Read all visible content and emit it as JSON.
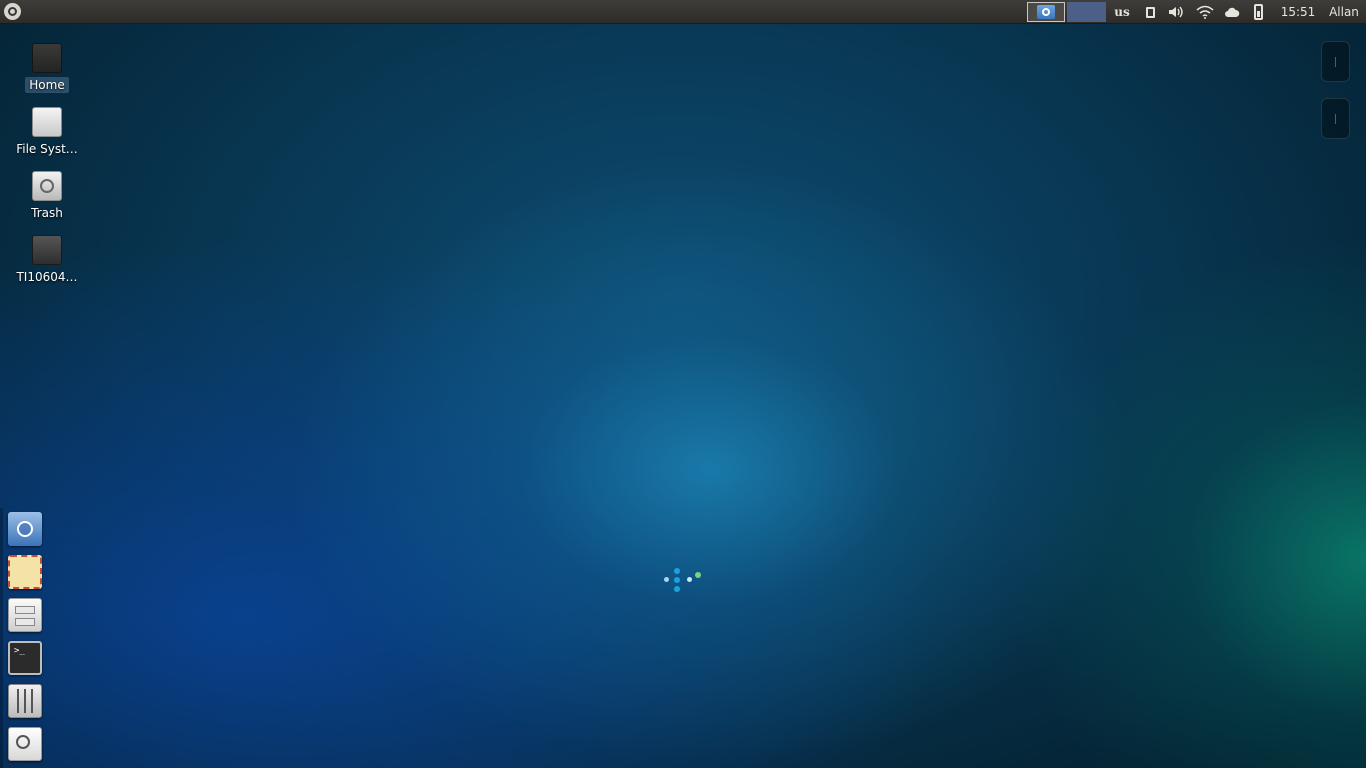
{
  "top_panel": {
    "keyboard_layout": "us",
    "clock": "15:51",
    "user": "Allan",
    "icons": [
      "xubuntu-menu-icon",
      "chromium-window-icon",
      "clipboard-icon",
      "volume-icon",
      "wifi-icon",
      "cloud-icon",
      "battery-icon"
    ]
  },
  "desktop": {
    "icons": [
      {
        "label": "Home",
        "icon": "home-folder-icon"
      },
      {
        "label": "File Syst…",
        "icon": "filesystem-icon"
      },
      {
        "label": "Trash",
        "icon": "trash-icon"
      },
      {
        "label": "TI10604…",
        "icon": "drive-icon"
      }
    ]
  },
  "dock": {
    "items": [
      "chromium-browser-icon",
      "mail-icon",
      "file-cabinet-icon",
      "terminal-icon",
      "settings-icon",
      "search-icon"
    ],
    "terminal_prompt": ">_"
  },
  "colors": {
    "panel": "#33322e",
    "workspace_active": "#4c5f86",
    "spinner_blue": "#1aa3e0",
    "spinner_green": "#7bd37a"
  }
}
